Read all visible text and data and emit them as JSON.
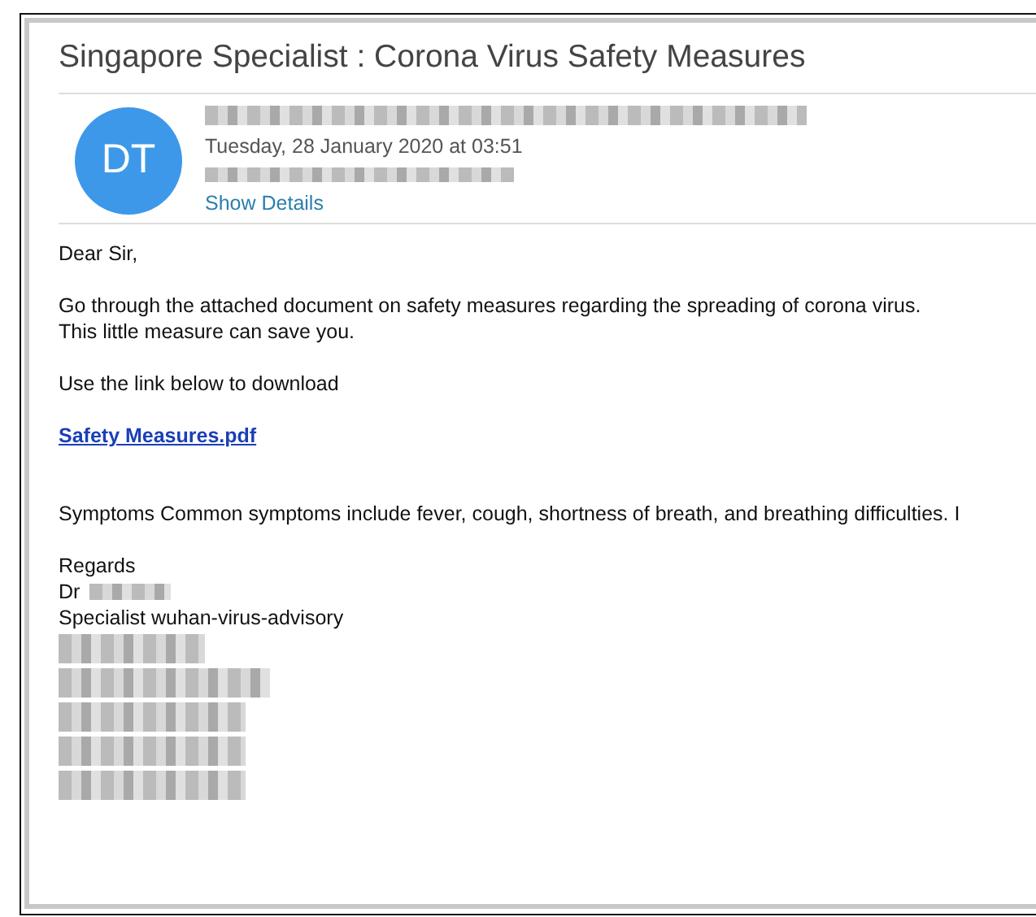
{
  "email": {
    "subject": "Singapore Specialist  : Corona Virus Safety Measures",
    "avatar": {
      "initials": "DT",
      "color": "#3d98ea"
    },
    "sender": {
      "redacted": true
    },
    "date": "Tuesday, 28 January 2020 at 03:51",
    "recipient": {
      "redacted": true
    },
    "show_details": "Show Details",
    "body": [
      {
        "kind": "text",
        "text": "Dear Sir,"
      },
      {
        "kind": "gap"
      },
      {
        "kind": "text",
        "text": "Go through the attached document on safety measures regarding the spreading of corona virus."
      },
      {
        "kind": "text",
        "text": "This little measure can save you."
      },
      {
        "kind": "gap"
      },
      {
        "kind": "text",
        "text": "Use the link below to download"
      },
      {
        "kind": "gap"
      },
      {
        "kind": "link",
        "text": "Safety Measures.pdf"
      },
      {
        "kind": "gap"
      },
      {
        "kind": "gap"
      },
      {
        "kind": "text",
        "text": "Symptoms  Common symptoms include fever, cough, shortness of breath, and breathing difficulties. I"
      },
      {
        "kind": "gap"
      },
      {
        "kind": "text",
        "text": "Regards"
      },
      {
        "kind": "name",
        "text": "Dr",
        "redacted": true
      },
      {
        "kind": "text",
        "text": "Specialist wuhan-virus-advisory"
      },
      {
        "kind": "redacted",
        "redacted": true
      },
      {
        "kind": "redacted",
        "redacted": true
      },
      {
        "kind": "redacted",
        "redacted": true
      },
      {
        "kind": "redacted",
        "redacted": true
      },
      {
        "kind": "redacted",
        "redacted": true
      }
    ]
  }
}
